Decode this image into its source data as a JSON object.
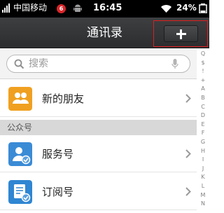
{
  "status_bar": {
    "carrier": "中国移动",
    "notification_count": "6",
    "time": "16:45",
    "battery": "24%"
  },
  "header": {
    "title": "通讯录",
    "add_icon": "plus-icon"
  },
  "search": {
    "placeholder": "搜索"
  },
  "contacts": {
    "items": [
      {
        "label": "新的朋友",
        "icon": "new-friends-icon",
        "color": "#f0a020"
      },
      {
        "label": "服务号",
        "icon": "service-account-icon",
        "color": "#3a8bd6"
      },
      {
        "label": "订阅号",
        "icon": "subscription-account-icon",
        "color": "#2f86d2"
      }
    ],
    "section_title": "公众号"
  },
  "index_bar": {
    "letters": [
      "Q",
      "$",
      "!",
      "+",
      "A",
      "B",
      "C",
      "D",
      "E",
      "F",
      "G",
      "H",
      "I",
      "J",
      "K",
      "L",
      "M",
      "N"
    ]
  },
  "colors": {
    "title_bar": "#333537",
    "highlight_border": "#e01e1e"
  }
}
